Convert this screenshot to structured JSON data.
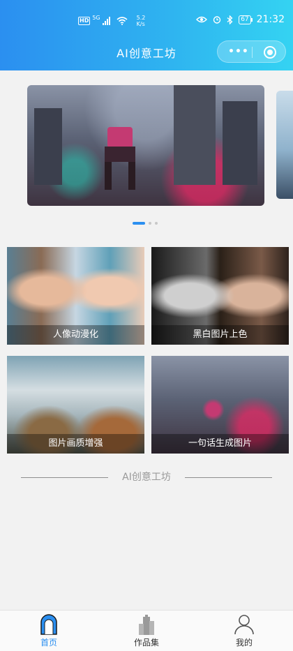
{
  "status_bar": {
    "hd": "HD",
    "signal": "5G",
    "speed_value": "5.2",
    "speed_unit": "K/s",
    "battery": "67",
    "time": "21:32"
  },
  "header": {
    "title": "AI创意工坊",
    "more_label": "•••"
  },
  "banner": {
    "slide_count": 3,
    "active_index": 0
  },
  "features": [
    {
      "label": "人像动漫化"
    },
    {
      "label": "黑白图片上色"
    },
    {
      "label": "图片画质增强"
    },
    {
      "label": "一句话生成图片"
    }
  ],
  "section": {
    "title": "AI创意工坊"
  },
  "tabbar": {
    "items": [
      {
        "label": "首页",
        "active": true,
        "icon": "home-arch-icon"
      },
      {
        "label": "作品集",
        "active": false,
        "icon": "building-icon"
      },
      {
        "label": "我的",
        "active": false,
        "icon": "user-icon"
      }
    ]
  },
  "colors": {
    "accent": "#2b8ff0",
    "header_gradient_start": "#2b8ff0",
    "header_gradient_end": "#34d3f2"
  }
}
